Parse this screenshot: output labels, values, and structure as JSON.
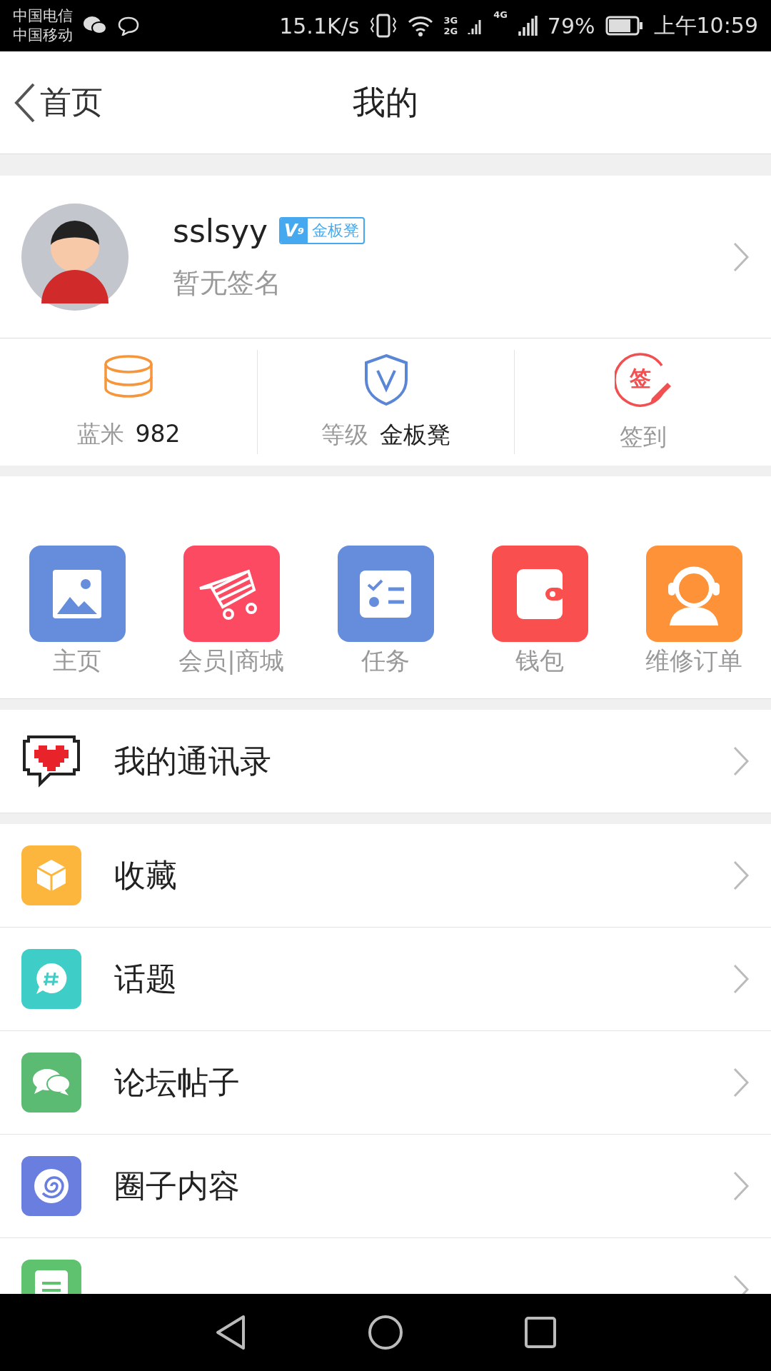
{
  "status_bar": {
    "carriers": [
      "中国电信",
      "中国移动"
    ],
    "speed": "15.1K/s",
    "network_top": "3G",
    "network_bottom": "2G",
    "network_4g": "4G",
    "battery": "79%",
    "time": "上午10:59"
  },
  "header": {
    "back": "首页",
    "title": "我的"
  },
  "profile": {
    "name": "sslsyy",
    "badge": {
      "mark": "V",
      "sub": "9",
      "label": "金板凳"
    },
    "signature": "暂无签名"
  },
  "stats": [
    {
      "kind": "coins",
      "label": "蓝米",
      "value": "982"
    },
    {
      "kind": "shield",
      "label": "等级",
      "value": "金板凳"
    },
    {
      "kind": "sign",
      "icon_text": "签",
      "label": "签到"
    }
  ],
  "shortcuts": [
    {
      "kind": "picture",
      "color": "#658ddc",
      "label": "主页"
    },
    {
      "kind": "cart",
      "color": "#fb4a62",
      "label": "会员|商城"
    },
    {
      "kind": "tasks",
      "color": "#658ddc",
      "label": "任务"
    },
    {
      "kind": "wallet",
      "color": "#fa4f4f",
      "label": "钱包"
    },
    {
      "kind": "headset",
      "color": "#fd9238",
      "label": "维修订单"
    }
  ],
  "contacts": {
    "label": "我的通讯录"
  },
  "menu": [
    {
      "kind": "box",
      "color": "#fdb63d",
      "label": "收藏"
    },
    {
      "kind": "hashtag",
      "color": "#3fcec7",
      "label": "话题"
    },
    {
      "kind": "chat",
      "color": "#5bbb73",
      "label": "论坛帖子"
    },
    {
      "kind": "swirl",
      "color": "#6a7ee0",
      "label": "圈子内容"
    },
    {
      "kind": "draft",
      "color": "#5fc26f"
    }
  ]
}
